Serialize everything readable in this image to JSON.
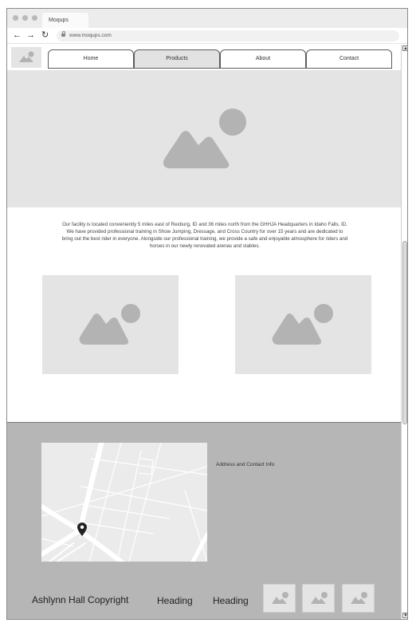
{
  "browser": {
    "tab_title": "Moqups",
    "url": "www.moqups.com",
    "back_icon": "←",
    "forward_icon": "→",
    "reload_icon": "↻"
  },
  "nav": {
    "items": [
      {
        "label": "Home",
        "active": false
      },
      {
        "label": "Products",
        "active": true
      },
      {
        "label": "About",
        "active": false
      },
      {
        "label": "Contact",
        "active": false
      }
    ]
  },
  "main": {
    "description": "Our facility is located conveniently 5 miles east of Rexburg, ID and 36 miles north from the GHHJA Headquarters in Idaho Falls, ID. We have provided professional training in Show Jumping, Dressage, and Cross Country for over 15 years and are dedicated to bring out the best rider in everyone. Alongside our professional training, we provide a safe and enjoyable atmosphere for riders and horses in our newly renovated arenas and stables."
  },
  "footer": {
    "address_label": "Address and Contact Info",
    "copyright": "Ashlynn Hall Copyright",
    "heading_1": "Heading",
    "heading_2": "Heading"
  },
  "colors": {
    "placeholder_bg": "#e4e4e4",
    "placeholder_icon": "#b3b3b3",
    "footer_bg": "#b6b6b6",
    "map_bg": "#ebebeb"
  }
}
